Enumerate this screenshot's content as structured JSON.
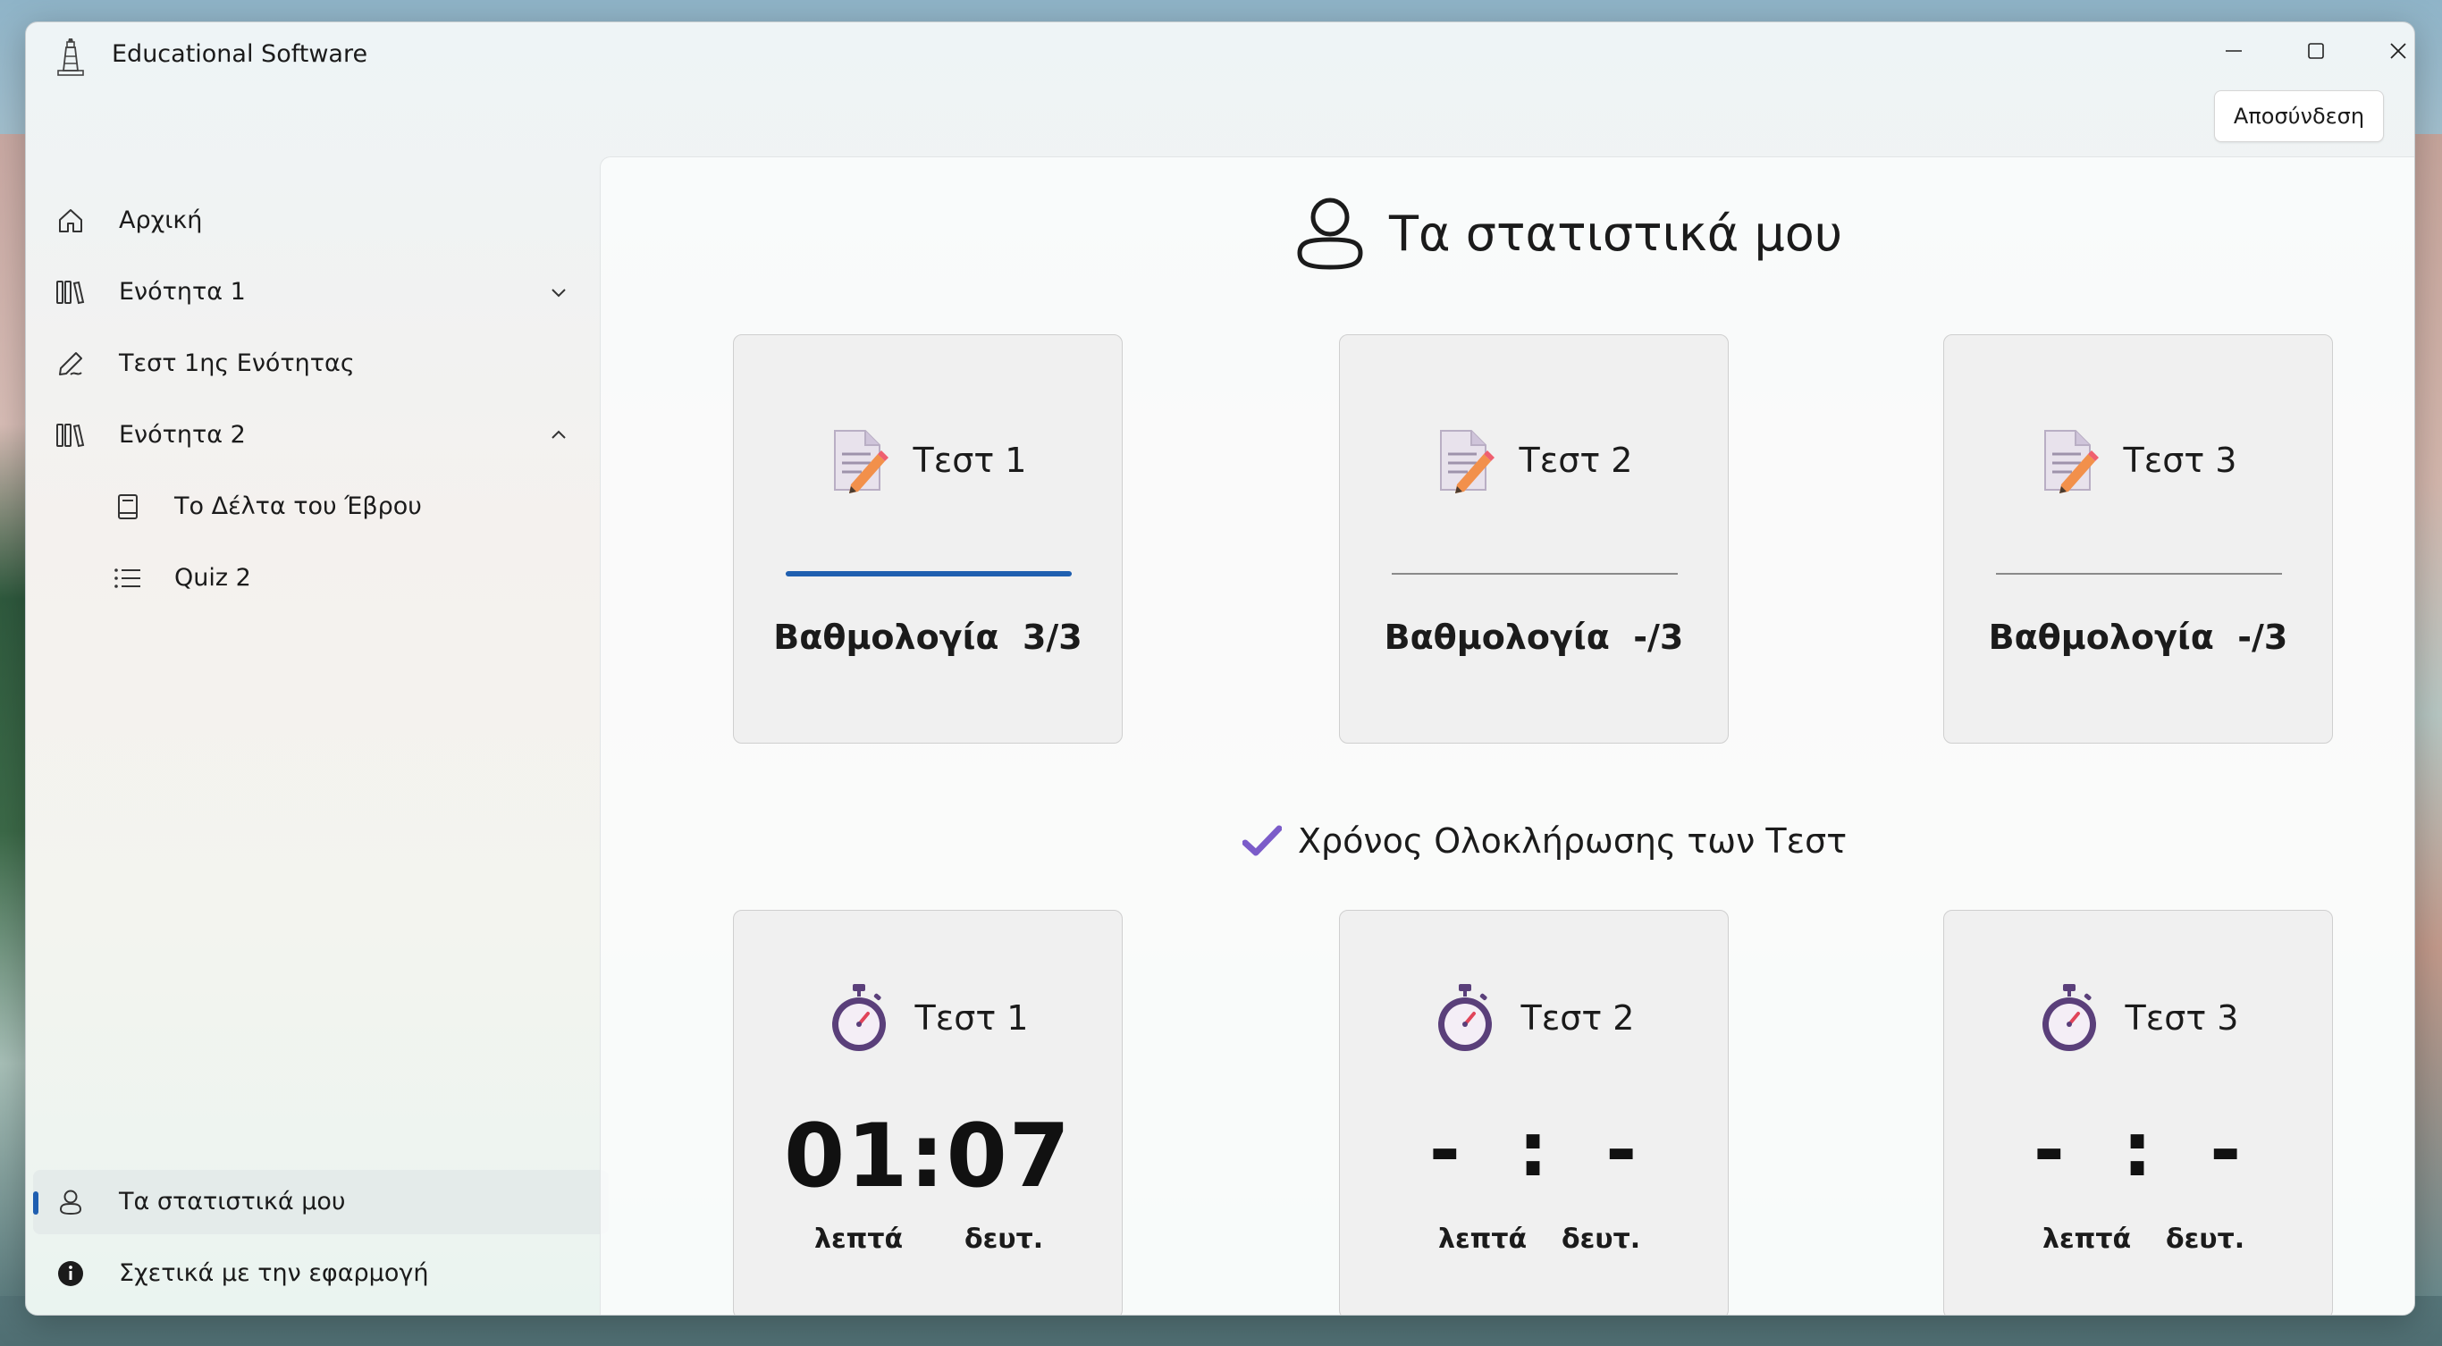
{
  "window": {
    "title": "Educational Software",
    "logout_label": "Αποσύνδεση"
  },
  "sidebar": {
    "items": [
      {
        "label": "Αρχική",
        "icon": "home-icon"
      },
      {
        "label": "Ενότητα 1",
        "icon": "books-icon",
        "expanded": false
      },
      {
        "label": "Τεστ 1ης Ενότητας",
        "icon": "pen-icon"
      },
      {
        "label": "Ενότητα 2",
        "icon": "books-icon",
        "expanded": true
      },
      {
        "label": "Το Δέλτα του Έβρου",
        "icon": "book-icon"
      },
      {
        "label": "Quiz 2",
        "icon": "list-icon"
      }
    ],
    "footer": [
      {
        "label": "Τα στατιστικά μου",
        "icon": "person-icon",
        "selected": true
      },
      {
        "label": "Σχετικά με την εφαρμογή",
        "icon": "info-icon"
      }
    ]
  },
  "main": {
    "title": "Τα στατιστικά μου",
    "tests": [
      {
        "title": "Τεστ 1",
        "score_label": "Βαθμολογία",
        "score": "3/3",
        "progress": 1.0
      },
      {
        "title": "Τεστ 2",
        "score_label": "Βαθμολογία",
        "score": "-/3",
        "progress": 0
      },
      {
        "title": "Τεστ 3",
        "score_label": "Βαθμολογία",
        "score": "-/3",
        "progress": 0
      }
    ],
    "times_title": "Χρόνος Ολοκλήρωσης των Τεστ",
    "times": [
      {
        "title": "Τεστ 1",
        "minutes": "01",
        "seconds": "07"
      },
      {
        "title": "Τεστ 2",
        "minutes": "-",
        "seconds": "-"
      },
      {
        "title": "Τεστ 3",
        "minutes": "-",
        "seconds": "-"
      }
    ],
    "minutes_label": "λεπτά",
    "seconds_label": "δευτ."
  },
  "colors": {
    "accent": "#1f5fb0",
    "check": "#7b5cc9"
  }
}
